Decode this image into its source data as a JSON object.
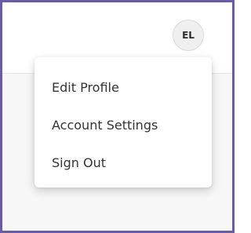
{
  "avatar": {
    "initials": "EL"
  },
  "menu": {
    "items": [
      {
        "label": "Edit Profile"
      },
      {
        "label": "Account Settings"
      },
      {
        "label": "Sign Out"
      }
    ]
  },
  "colors": {
    "frame_border": "#6b5aa6",
    "menu_background": "#ffffff",
    "avatar_background": "#efefef",
    "text": "#333333"
  }
}
